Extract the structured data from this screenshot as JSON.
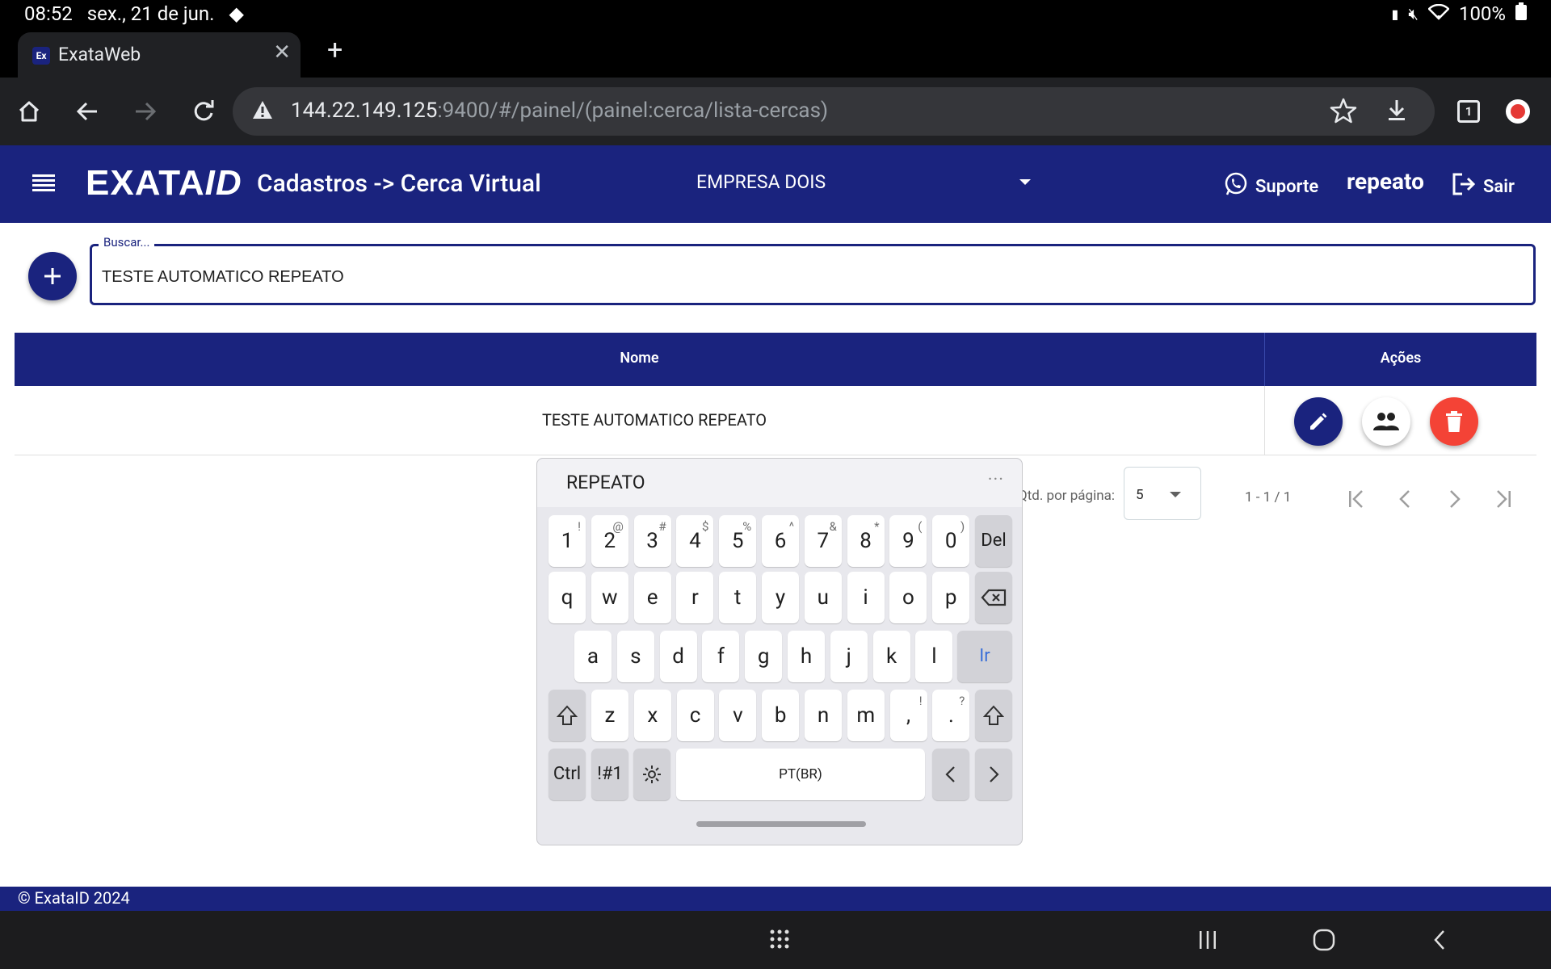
{
  "status_bar": {
    "time": "08:52",
    "date": "sex., 21 de jun.",
    "battery": "100%"
  },
  "browser": {
    "tab_title": "ExataWeb",
    "tab_favicon": "Ex",
    "url_host": "144.22.149.125",
    "url_rest": ":9400/#/painel/(painel:cerca/lista-cercas)",
    "tab_count": "1"
  },
  "header": {
    "logo_main": "EXATA",
    "logo_id": "ID",
    "page_title": "Cadastros -> Cerca Virtual",
    "company": "EMPRESA DOIS",
    "support_label": "Suporte",
    "username": "repeato",
    "logout_label": "Sair"
  },
  "search": {
    "label": "Buscar...",
    "value": "TESTE AUTOMATICO REPEATO"
  },
  "table": {
    "columns": [
      "Nome",
      "Ações"
    ],
    "rows": [
      {
        "nome": "TESTE AUTOMATICO REPEATO"
      }
    ]
  },
  "paginator": {
    "per_page_label": "Qtd. por página:",
    "per_page_value": "5",
    "range": "1 - 1 / 1"
  },
  "keyboard": {
    "suggestion": "REPEATO",
    "more": "···",
    "row1": [
      {
        "k": "1",
        "s": "!"
      },
      {
        "k": "2",
        "s": "@"
      },
      {
        "k": "3",
        "s": "#"
      },
      {
        "k": "4",
        "s": "$"
      },
      {
        "k": "5",
        "s": "%"
      },
      {
        "k": "6",
        "s": "^"
      },
      {
        "k": "7",
        "s": "&"
      },
      {
        "k": "8",
        "s": "*"
      },
      {
        "k": "9",
        "s": "("
      },
      {
        "k": "0",
        "s": ")"
      }
    ],
    "row2": [
      "q",
      "w",
      "e",
      "r",
      "t",
      "y",
      "u",
      "i",
      "o",
      "p"
    ],
    "row3": [
      "a",
      "s",
      "d",
      "f",
      "g",
      "h",
      "j",
      "k",
      "l"
    ],
    "row4": [
      "z",
      "x",
      "c",
      "v",
      "b",
      "n",
      "m"
    ],
    "row4_punct": [
      {
        "k": ",",
        "s": "!"
      },
      {
        "k": ".",
        "s": "?"
      }
    ],
    "del": "Del",
    "go": "Ir",
    "ctrl": "Ctrl",
    "sym": "!#1",
    "space": "PT(BR)"
  },
  "footer": {
    "text": "© ExataID 2024"
  },
  "colors": {
    "primary": "#1a237e",
    "danger": "#f44336",
    "go_key_text": "#3a6fd8"
  }
}
